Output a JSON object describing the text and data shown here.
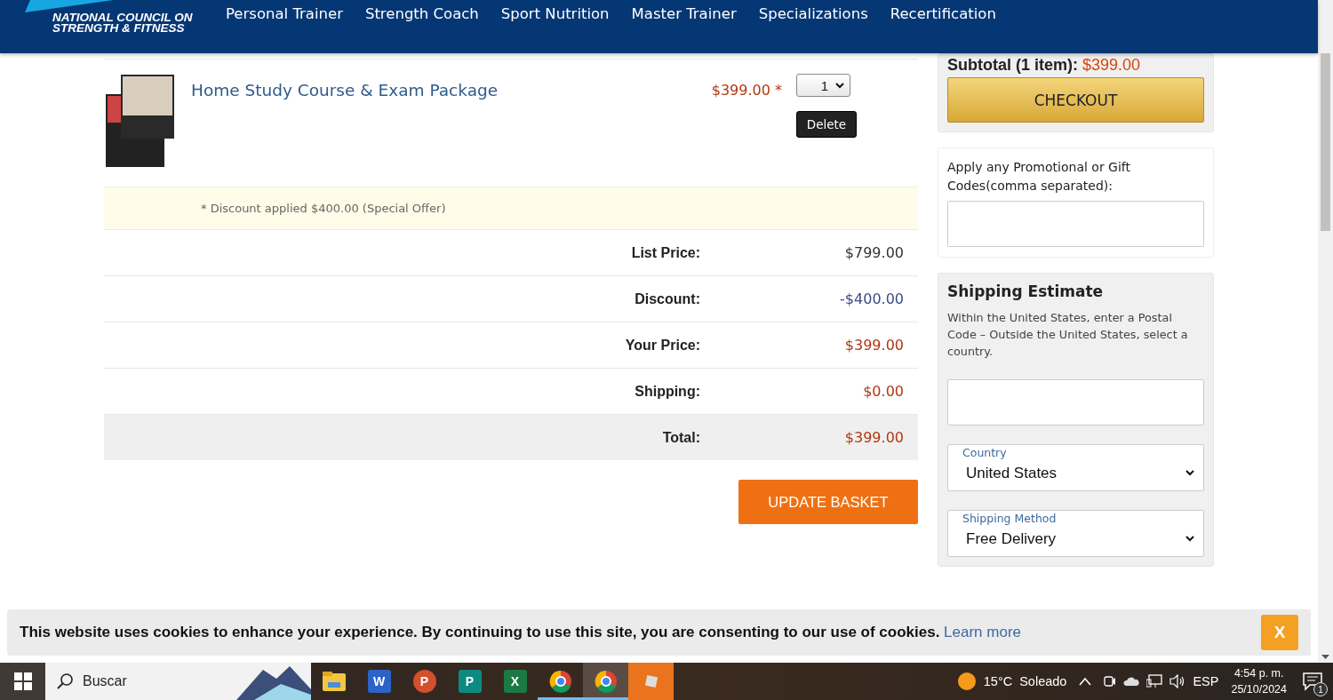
{
  "header": {
    "logo_lines": [
      "NATIONAL COUNCIL ON",
      "STRENGTH & FITNESS"
    ],
    "nav": [
      "Personal Trainer",
      "Strength Coach",
      "Sport Nutrition",
      "Master Trainer",
      "Specializations",
      "Recertification"
    ]
  },
  "cart": {
    "item": {
      "title": "Home Study Course & Exam Package",
      "price": "$399.00 *",
      "quantity": "1",
      "delete_button": "Delete"
    },
    "note": "* Discount applied $400.00 (Special Offer)",
    "summary": [
      {
        "label": "List Price:",
        "value": "$799.00",
        "kind": "plain"
      },
      {
        "label": "Discount:",
        "value": "-$400.00",
        "kind": "discount"
      },
      {
        "label": "Your Price:",
        "value": "$399.00",
        "kind": "price"
      },
      {
        "label": "Shipping:",
        "value": "$0.00",
        "kind": "price"
      },
      {
        "label": "Total:",
        "value": "$399.00",
        "kind": "total"
      }
    ],
    "update_button": "UPDATE BASKET"
  },
  "sidebar": {
    "subtotal_label": "Subtotal (1 item):",
    "subtotal_value": "$399.00",
    "checkout_button": "CHECKOUT",
    "promo_label": "Apply any Promotional or Gift Codes(comma separated):",
    "shipping": {
      "title": "Shipping Estimate",
      "text": "Within the United States, enter a Postal Code – Outside the United States, select a country.",
      "country": {
        "label": "Country",
        "value": "United States"
      },
      "method": {
        "label": "Shipping Method",
        "value": "Free Delivery"
      }
    }
  },
  "cookie_banner": {
    "text": "This website uses cookies to enhance your experience. By continuing to use this site, you are consenting to our use of cookies.",
    "link": "Learn more",
    "close_button": "X"
  },
  "taskbar": {
    "search_placeholder": "Buscar",
    "apps": [
      {
        "kind": "folder",
        "open": false,
        "selected": false
      },
      {
        "kind": "word",
        "letter": "W",
        "open": false,
        "selected": false
      },
      {
        "kind": "powerpoint",
        "letter": "P",
        "open": false,
        "selected": false
      },
      {
        "kind": "publisher",
        "letter": "P",
        "open": false,
        "selected": false
      },
      {
        "kind": "excel",
        "letter": "X",
        "open": false,
        "selected": false
      },
      {
        "kind": "chrome",
        "open": true,
        "selected": false
      },
      {
        "kind": "chrome",
        "open": true,
        "selected": true
      },
      {
        "kind": "tile",
        "open": false,
        "selected": false
      }
    ],
    "temperature": "15°C",
    "weather": "Soleado",
    "language": "ESP",
    "time": "4:54 p. m.",
    "date": "25/10/2024",
    "notification_count": "1"
  }
}
